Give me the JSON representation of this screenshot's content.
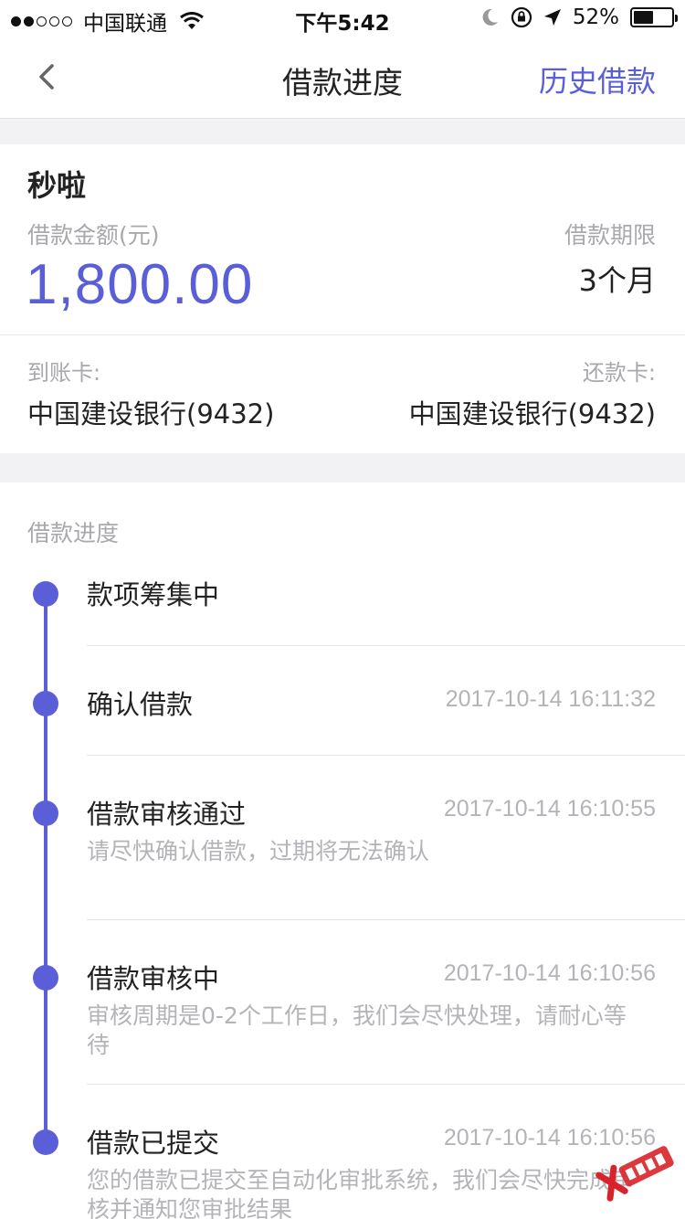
{
  "status_bar": {
    "carrier": "中国联通",
    "time": "下午5:42",
    "battery": "52%",
    "battery_level": 0.52
  },
  "nav": {
    "title": "借款进度",
    "right_action": "历史借款"
  },
  "loan": {
    "product": "秒啦",
    "amount_label": "借款金额(元)",
    "amount": "1,800.00",
    "term_label": "借款期限",
    "term": "3个月",
    "receive_card_label": "到账卡:",
    "receive_card": "中国建设银行(9432)",
    "repay_card_label": "还款卡:",
    "repay_card": "中国建设银行(9432)"
  },
  "progress": {
    "title": "借款进度",
    "steps": [
      {
        "title": "款项筹集中",
        "time": "",
        "desc": ""
      },
      {
        "title": "确认借款",
        "time": "2017-10-14 16:11:32",
        "desc": ""
      },
      {
        "title": "借款审核通过",
        "time": "2017-10-14 16:10:55",
        "desc": "请尽快确认借款，过期将无法确认"
      },
      {
        "title": "借款审核中",
        "time": "2017-10-14 16:10:56",
        "desc": "审核周期是0-2个工作日，我们会尽快处理，请耐心等待"
      },
      {
        "title": "借款已提交",
        "time": "2017-10-14 16:10:56",
        "desc": "您的借款已提交至自动化审批系统，我们会尽快完成审核并通知您审批结果"
      }
    ]
  },
  "watermark": {
    "text": "卡农社区"
  },
  "colors": {
    "accent": "#5a5fd8",
    "muted": "#a8a8ad",
    "background": "#f2f2f4"
  }
}
